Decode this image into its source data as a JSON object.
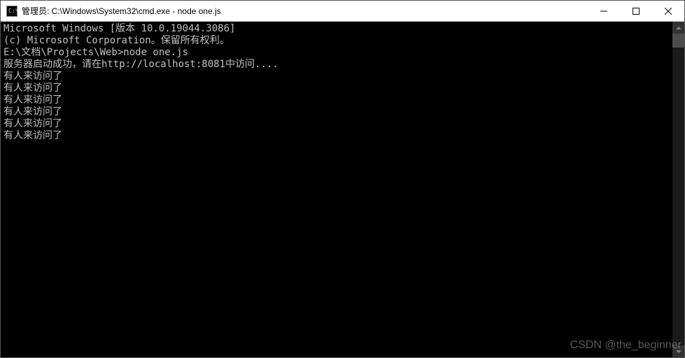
{
  "titlebar": {
    "title": "管理员: C:\\Windows\\System32\\cmd.exe - node  one.js",
    "icon_name": "cmd-icon"
  },
  "window_controls": {
    "minimize": "─",
    "maximize": "☐",
    "close": "✕"
  },
  "console": {
    "lines": [
      "Microsoft Windows [版本 10.0.19044.3086]",
      "(c) Microsoft Corporation。保留所有权利。",
      "",
      "E:\\文档\\Projects\\Web>node one.js",
      "服务器启动成功，请在http://localhost:8081中访问....",
      "有人来访问了",
      "有人来访问了",
      "有人来访问了",
      "有人来访问了",
      "有人来访问了",
      "有人来访问了"
    ]
  },
  "watermark": "CSDN @the_beginner"
}
